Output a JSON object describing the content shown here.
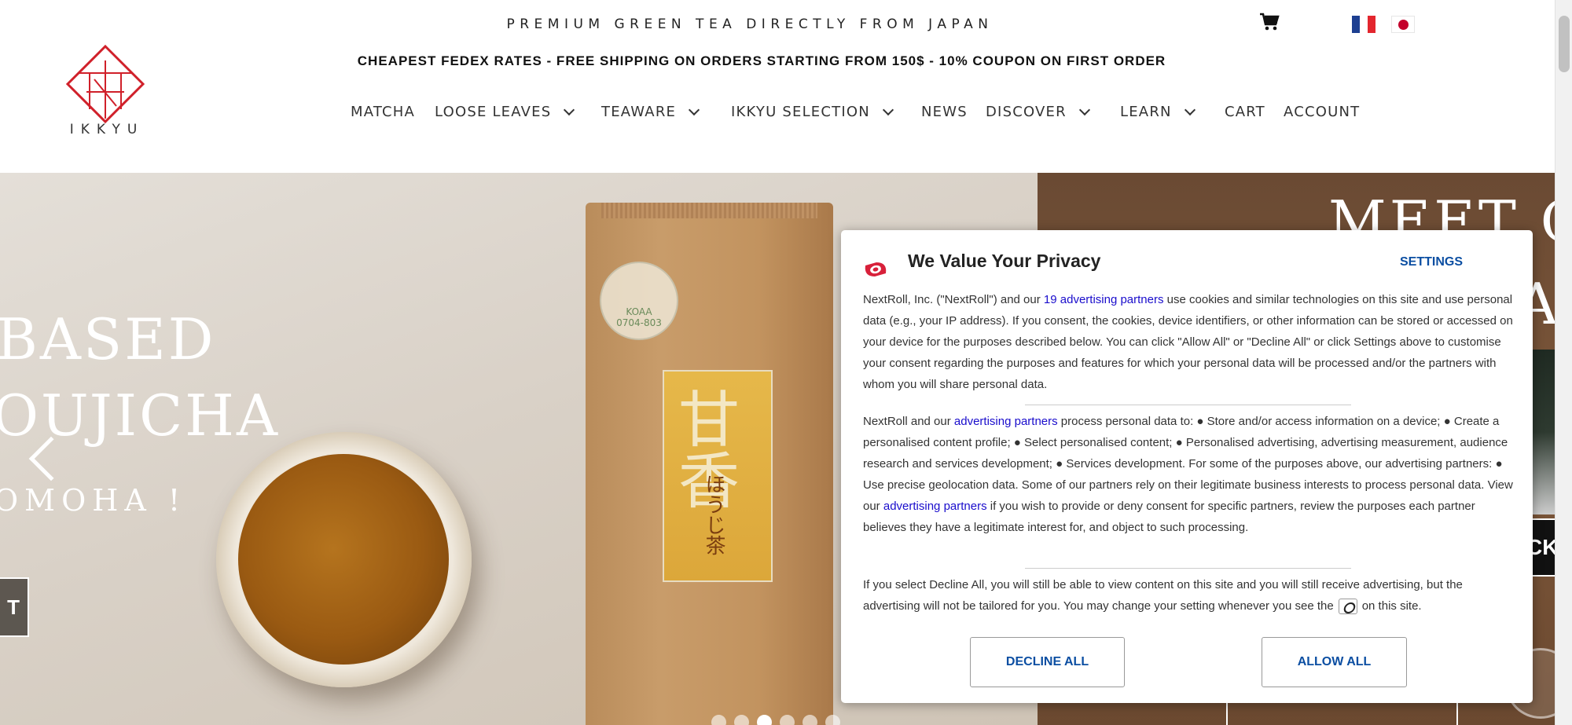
{
  "header": {
    "tagline": "PREMIUM GREEN TEA DIRECTLY FROM JAPAN",
    "promo": "CHEAPEST FEDEX RATES - FREE SHIPPING ON ORDERS STARTING FROM 150$ - 10% COUPON ON FIRST ORDER",
    "logo_text": "IKKYU",
    "icons": [
      "cart-icon",
      "flag-france-icon",
      "flag-japan-icon"
    ],
    "nav": [
      {
        "label": "MATCHA",
        "dropdown": false
      },
      {
        "label": "LOOSE LEAVES",
        "dropdown": true
      },
      {
        "label": "TEAWARE",
        "dropdown": true
      },
      {
        "label": "IKKYU SELECTION",
        "dropdown": true
      },
      {
        "label": "NEWS",
        "dropdown": false
      },
      {
        "label": "DISCOVER",
        "dropdown": true
      },
      {
        "label": "LEARN",
        "dropdown": true
      },
      {
        "label": "CART",
        "dropdown": false
      },
      {
        "label": "ACCOUNT",
        "dropdown": false
      }
    ]
  },
  "hero": {
    "line1": "BASED",
    "line2": "OUJICHA",
    "line3": "OMOHA !",
    "button_label": "T",
    "right_heading": "MEET OU",
    "right_a": "A",
    "right_ck": "CK",
    "slide_count": 6,
    "active_slide": 3,
    "jas_label": "KOAA\n0704-803",
    "product_kanji": "甘香",
    "product_sub": "ほうじ茶"
  },
  "privacy": {
    "title": "We Value Your Privacy",
    "settings_label": "SETTINGS",
    "p1": {
      "before": "NextRoll, Inc. (\"NextRoll\") and our ",
      "link": "19 advertising partners",
      "after": " use cookies and similar technologies on this site and use personal data (e.g., your IP address). If you consent, the cookies, device identifiers, or other information can be stored or accessed on your device for the purposes described below. You can click \"Allow All\" or \"Decline All\" or click Settings above to customise your consent regarding the purposes and features for which your personal data will be processed and/or the partners with whom you will share personal data."
    },
    "p2": {
      "before": "NextRoll and our ",
      "link1": "advertising partners",
      "middle": " process personal data to: ● Store and/or access information on a device; ● Create a personalised content profile; ● Select personalised content; ● Personalised advertising, advertising measurement, audience research and services development; ● Services development. For some of the purposes above, our advertising partners: ● Use precise geolocation data. Some of our partners rely on their legitimate business interests to process personal data. View our ",
      "link2": "advertising partners",
      "after": " if you wish to provide or deny consent for specific partners, review the purposes each partner believes they have a legitimate interest for, and object to such processing."
    },
    "p3": {
      "before": "If you select Decline All, you will still be able to view content on this site and you will still receive advertising, but the advertising will not be tailored for you. You may change your setting whenever you see the",
      "after": "on this site."
    },
    "decline_label": "DECLINE ALL",
    "allow_label": "ALLOW ALL"
  }
}
